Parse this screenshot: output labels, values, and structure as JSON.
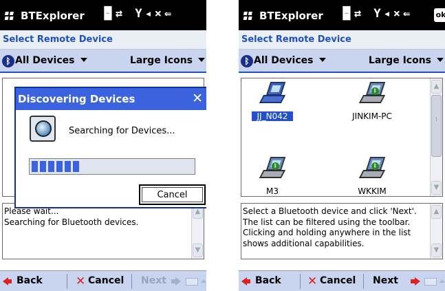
{
  "colors": {
    "accent": "#3b63e0",
    "header_text": "#2050c0",
    "toolbar_bg": "#c9d4ee",
    "danger": "#dd2222",
    "disabled": "#9aa4ba"
  },
  "screens": [
    {
      "title": "BTExplorer",
      "system_icons": "🁢⇄ Y◂×⇚",
      "header": "Select Remote Device",
      "filter_label": "All Devices",
      "view_label": "Large Icons",
      "dialog": {
        "title": "Discovering Devices",
        "close_glyph": "✕",
        "status": "Searching for Devices...",
        "progress_segments": 6,
        "cancel_label": "Cancel"
      },
      "info_text": "Please wait...\nSearching for Bluetooth devices.",
      "bottom": {
        "back": "Back",
        "cancel": "Cancel",
        "next": "Next"
      }
    },
    {
      "title": "BTExplorer",
      "system_icons": "🁢⇄ Y◂×⇚",
      "ok_label": "ok",
      "header": "Select Remote Device",
      "filter_label": "All Devices",
      "view_label": "Large Icons",
      "devices": [
        {
          "name": "JJ_N042",
          "selected": true
        },
        {
          "name": "JINKIM-PC",
          "selected": false
        },
        {
          "name": "M3",
          "selected": false
        },
        {
          "name": "WKKIM",
          "selected": false
        }
      ],
      "info_text": "Select a Bluetooth device and click 'Next'.\nThe list can be filtered using the toolbar.\nClicking and holding anywhere in the list\nshows additional capabilities.",
      "bottom": {
        "back": "Back",
        "cancel": "Cancel",
        "next": "Next"
      }
    }
  ]
}
